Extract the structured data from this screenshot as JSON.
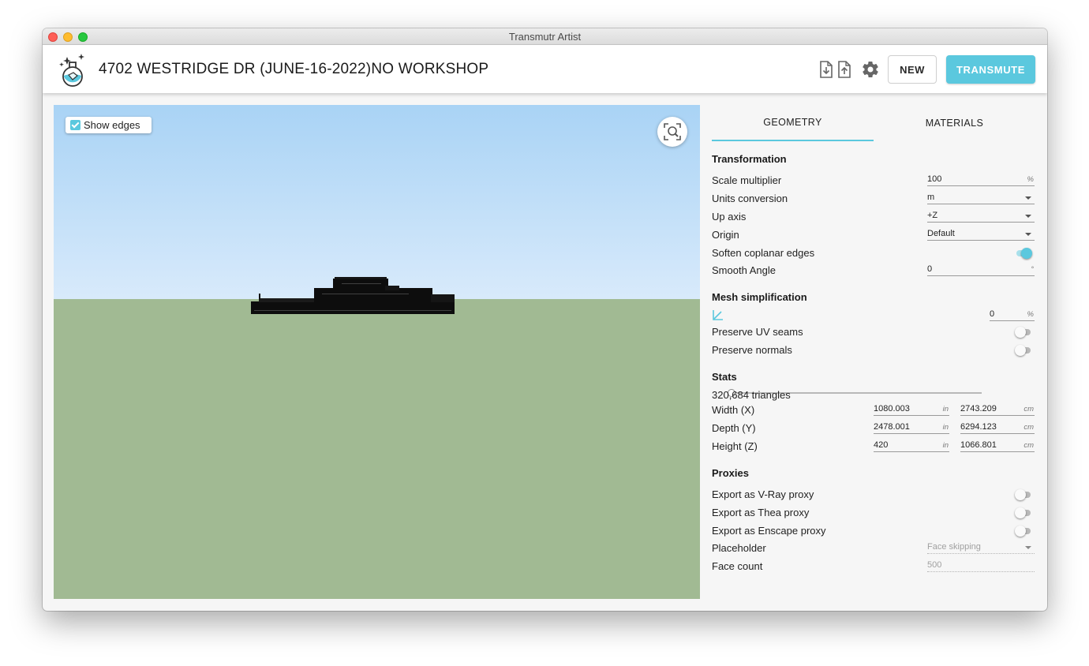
{
  "window": {
    "title": "Transmutr Artist"
  },
  "header": {
    "project_title": "4702 WESTRIDGE DR (JUNE-16-2022)NO WORKSHOP",
    "new_label": "NEW",
    "transmute_label": "TRANSMUTE",
    "icons": [
      "import-file-icon",
      "export-file-icon",
      "gear-icon"
    ],
    "accent": "#5bc8de"
  },
  "viewport": {
    "show_edges_label": "Show edges",
    "show_edges_checked": true,
    "sky_color": "#a9d3f5",
    "ground_color": "#a1ba93"
  },
  "tabs": {
    "geometry": "GEOMETRY",
    "materials": "MATERIALS",
    "active": "GEOMETRY"
  },
  "transformation": {
    "title": "Transformation",
    "scale": {
      "label": "Scale multiplier",
      "value": "100",
      "unit": "%"
    },
    "units": {
      "label": "Units conversion",
      "value": "m"
    },
    "up_axis": {
      "label": "Up axis",
      "value": "+Z"
    },
    "origin": {
      "label": "Origin",
      "value": "Default"
    },
    "soften": {
      "label": "Soften coplanar edges",
      "on": true
    },
    "smooth": {
      "label": "Smooth Angle",
      "value": "0",
      "unit": "°"
    }
  },
  "mesh": {
    "title": "Mesh simplification",
    "value": "0",
    "unit": "%",
    "slider_fraction": 0,
    "preserve_uv": {
      "label": "Preserve UV seams",
      "on": false
    },
    "preserve_normals": {
      "label": "Preserve normals",
      "on": false
    }
  },
  "stats": {
    "title": "Stats",
    "triangles": "320,684 triangles",
    "width": {
      "label": "Width (X)",
      "in": "1080.003",
      "cm": "2743.209"
    },
    "depth": {
      "label": "Depth (Y)",
      "in": "2478.001",
      "cm": "6294.123"
    },
    "height": {
      "label": "Height (Z)",
      "in": "420",
      "cm": "1066.801"
    },
    "unit_in": "in",
    "unit_cm": "cm"
  },
  "proxies": {
    "title": "Proxies",
    "vray": {
      "label": "Export as V-Ray proxy",
      "on": false
    },
    "thea": {
      "label": "Export as Thea proxy",
      "on": false
    },
    "enscape": {
      "label": "Export as Enscape proxy",
      "on": false
    },
    "placeholder": {
      "label": "Placeholder",
      "value": "Face skipping"
    },
    "face_count": {
      "label": "Face count",
      "value": "500"
    }
  }
}
